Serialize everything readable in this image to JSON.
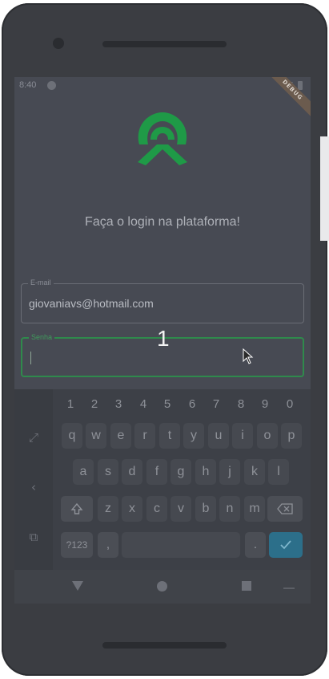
{
  "status": {
    "time": "8:40",
    "ribbon": "DEBUG"
  },
  "login": {
    "title": "Faça o login na plataforma!",
    "email": {
      "label": "E-mail",
      "value": "giovaniavs@hotmail.com"
    },
    "password": {
      "label": "Senha",
      "value": ""
    }
  },
  "overlay": {
    "digit": "1"
  },
  "keyboard": {
    "numbers": [
      "1",
      "2",
      "3",
      "4",
      "5",
      "6",
      "7",
      "8",
      "9",
      "0"
    ],
    "row1": [
      "q",
      "w",
      "e",
      "r",
      "t",
      "y",
      "u",
      "i",
      "o",
      "p"
    ],
    "row2": [
      "a",
      "s",
      "d",
      "f",
      "g",
      "h",
      "j",
      "k",
      "l"
    ],
    "row3": [
      "z",
      "x",
      "c",
      "v",
      "b",
      "n",
      "m"
    ],
    "symbols_label": "?123",
    "comma": ",",
    "period": ".",
    "side_icons": [
      "expand-icon",
      "chevron-left-icon",
      "split-keyboard-icon"
    ]
  },
  "colors": {
    "accent": "#2f8a4c",
    "logo": "#1f9a47",
    "enter": "#2c6f8a"
  }
}
